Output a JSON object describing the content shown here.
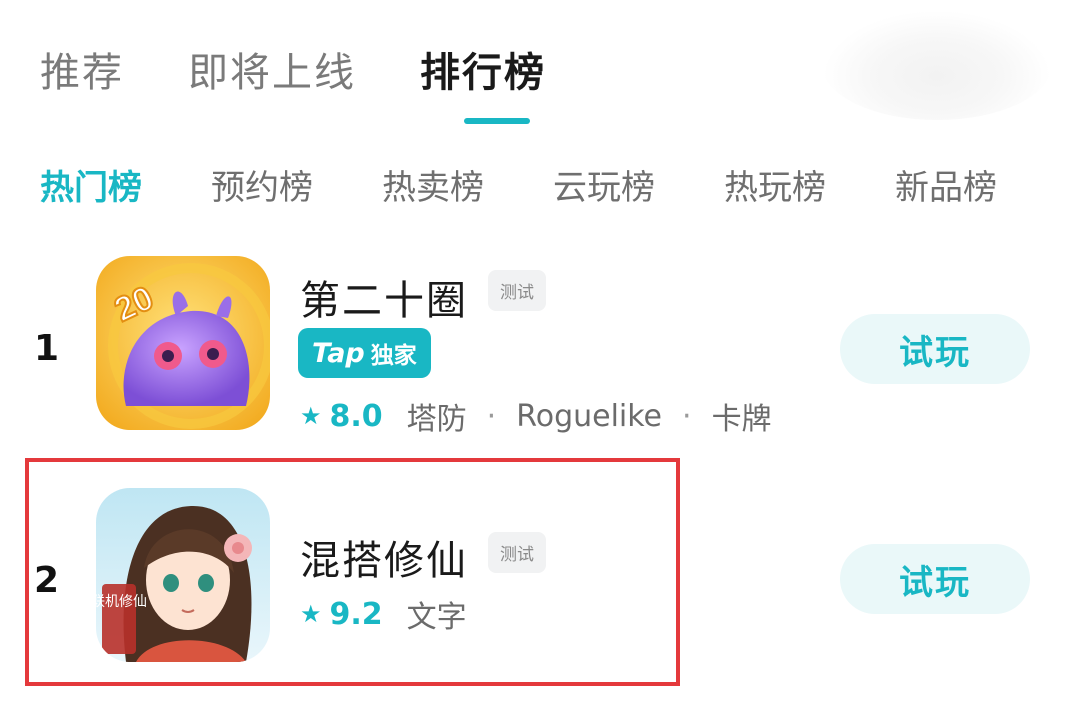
{
  "top_tabs": [
    "推荐",
    "即将上线",
    "排行榜"
  ],
  "sub_tabs": [
    "热门榜",
    "预约榜",
    "热卖榜",
    "云玩榜",
    "热玩榜",
    "新品榜"
  ],
  "apps": [
    {
      "rank": "1",
      "name": "第二十圈",
      "badge": "测试",
      "tap_label": "Tap",
      "exclusive_label": "独家",
      "rating": "8.0",
      "tags": [
        "塔防",
        "Roguelike",
        "卡牌"
      ],
      "action": "试玩",
      "icon_badge": "20"
    },
    {
      "rank": "2",
      "name": "混搭修仙",
      "badge": "测试",
      "rating": "9.2",
      "tags": [
        "文字"
      ],
      "action": "试玩",
      "icon_seal": "联机修仙"
    }
  ],
  "colors": {
    "accent": "#19b7c4",
    "highlight": "#e4393c"
  }
}
